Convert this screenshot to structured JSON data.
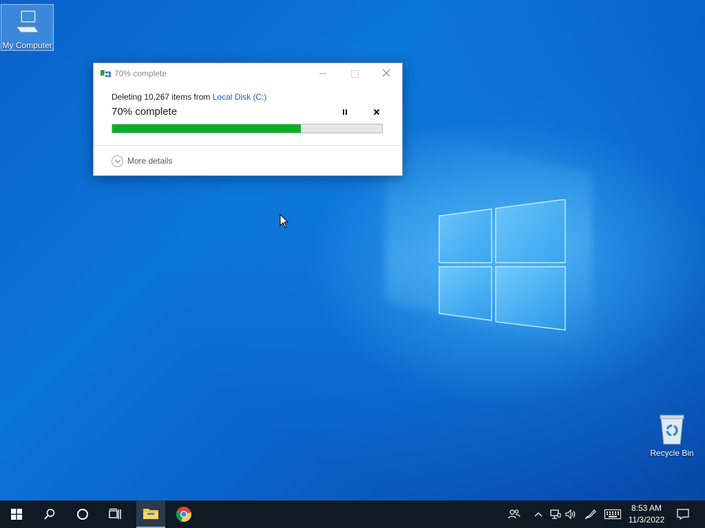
{
  "desktop": {
    "icons": [
      {
        "label": "My Computer"
      },
      {
        "label": "Recycle Bin"
      }
    ]
  },
  "dialog": {
    "title": "70% complete",
    "deleting_prefix": "Deleting 10,267 items from ",
    "source_link": "Local Disk (C:)",
    "percent_text": "70% complete",
    "progress": 0.7,
    "more_details": "More details"
  },
  "taskbar": {
    "clock_time": "8:53 AM",
    "clock_date": "11/3/2022"
  },
  "colors": {
    "progress_fill": "#06b025",
    "link": "#1a5fb4",
    "taskbar_bg": "#101a24"
  }
}
